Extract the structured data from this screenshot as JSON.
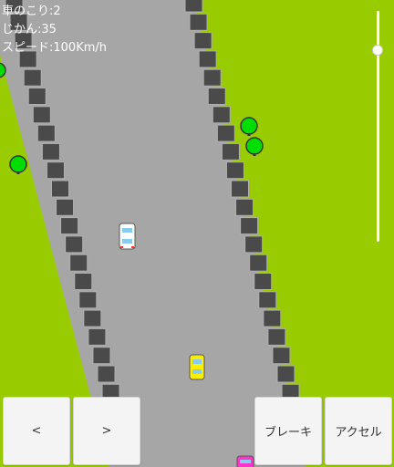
{
  "hud": {
    "cars_left": "車のこり:2",
    "time": "じかん:35",
    "speed": "スピード:100Km/h"
  },
  "controls": {
    "left_label": "<",
    "right_label": ">",
    "brake_label": "ブレーキ",
    "accel_label": "アクセル"
  },
  "speed_slider_level": 0.17,
  "colors": {
    "grass": "#99cc00",
    "road": "#a6a6a6",
    "curb_block": "#4a4a4a",
    "tree": "#00dd00",
    "player_car": "#ffffff",
    "yellow_car": "#ffee00",
    "pink_car": "#ff33cc"
  }
}
